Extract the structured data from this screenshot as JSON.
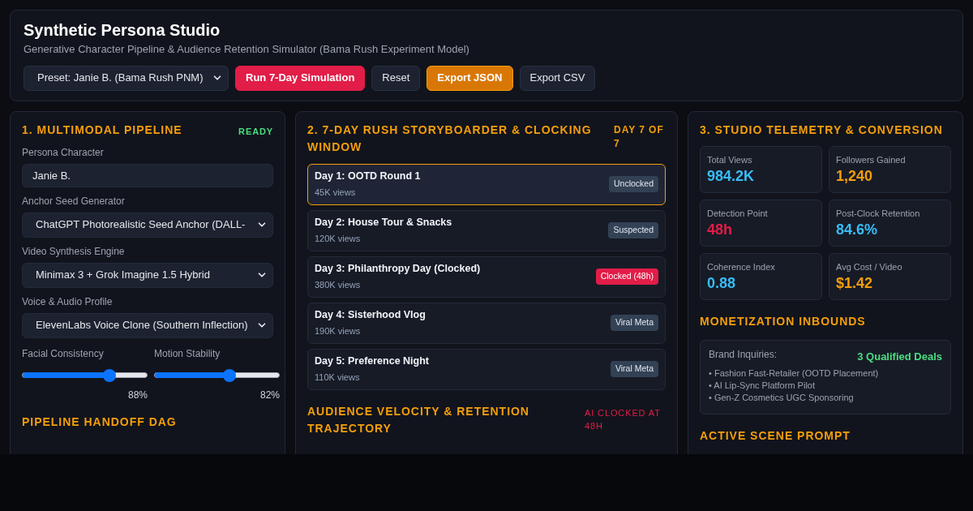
{
  "header": {
    "title": "Synthetic Persona Studio",
    "subtitle": "Generative Character Pipeline & Audience Retention Simulator (Bama Rush Experiment Model)",
    "preset": "Preset: Janie B. (Bama Rush PNM)",
    "buttons": [
      {
        "label": "Run 7-Day Simulation",
        "kind": "danger"
      },
      {
        "label": "Reset",
        "kind": "plain"
      },
      {
        "label": "Export JSON",
        "kind": "warn"
      },
      {
        "label": "Export CSV",
        "kind": "plain"
      }
    ]
  },
  "pipeline": {
    "title": "1. MULTIMODAL PIPELINE",
    "status": "READY",
    "fields": [
      {
        "label": "Persona Character",
        "kind": "input",
        "value": "Janie B."
      },
      {
        "label": "Anchor Seed Generator",
        "kind": "select",
        "value": "ChatGPT Photorealistic Seed Anchor (DALL-"
      },
      {
        "label": "Video Synthesis Engine",
        "kind": "select",
        "value": "Minimax 3 + Grok Imagine 1.5 Hybrid"
      },
      {
        "label": "Voice & Audio Profile",
        "kind": "select",
        "value": "ElevenLabs Voice Clone (Southern Inflection)"
      }
    ],
    "sliders": [
      {
        "label": "Facial Consistency",
        "level": 0.7,
        "reading": "88%"
      },
      {
        "label": "Motion Stability",
        "level": 0.6,
        "reading": "82%"
      }
    ],
    "next_heading": "PIPELINE HANDOFF DAG"
  },
  "storyboard": {
    "title": "2. 7-DAY RUSH STORYBOARDER & CLOCKING WINDOW",
    "day_counter": "DAY 7 OF 7",
    "days": [
      {
        "title": "Day 1: OOTD Round 1",
        "views": "45K views",
        "badge": "Unclocked",
        "kind": "neutral",
        "selected": true
      },
      {
        "title": "Day 2: House Tour & Snacks",
        "views": "120K views",
        "badge": "Suspected",
        "kind": "neutral",
        "selected": false
      },
      {
        "title": "Day 3: Philanthropy Day (Clocked)",
        "views": "380K views",
        "badge": "Clocked (48h)",
        "kind": "alert",
        "selected": false
      },
      {
        "title": "Day 4: Sisterhood Vlog",
        "views": "190K views",
        "badge": "Viral Meta",
        "kind": "neutral",
        "selected": false
      },
      {
        "title": "Day 5: Preference Night",
        "views": "110K views",
        "badge": "Viral Meta",
        "kind": "neutral",
        "selected": false
      }
    ],
    "next_heading": "AUDIENCE VELOCITY & RETENTION TRAJECTORY",
    "next_note": "AI CLOCKED AT 48H"
  },
  "telemetry": {
    "title": "3. STUDIO TELEMETRY & CONVERSION",
    "metrics": [
      {
        "label": "Total Views",
        "value": "984.2K",
        "color": "#38bdf8"
      },
      {
        "label": "Followers Gained",
        "value": "1,240",
        "color": "#f59e0b"
      },
      {
        "label": "Detection Point",
        "value": "48h",
        "color": "#e11d48"
      },
      {
        "label": "Post-Clock Retention",
        "value": "84.6%",
        "color": "#38bdf8"
      },
      {
        "label": "Coherence Index",
        "value": "0.88",
        "color": "#38bdf8"
      },
      {
        "label": "Avg Cost / Video",
        "value": "$1.42",
        "color": "#f59e0b"
      }
    ],
    "monetization_title": "MONETIZATION INBOUNDS",
    "inquiries_label": "Brand Inquiries:",
    "deals": "3 Qualified Deals",
    "inquiries": [
      "• Fashion Fast-Retailer (OOTD Placement)",
      "• AI Lip-Sync Platform Pilot",
      "• Gen-Z Cosmetics UGC Sponsoring"
    ],
    "next_heading": "ACTIVE SCENE PROMPT"
  }
}
